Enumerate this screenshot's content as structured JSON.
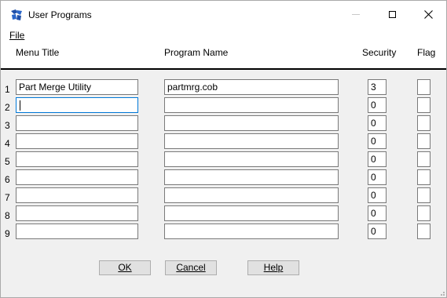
{
  "window": {
    "title": "User Programs",
    "icon": "app-icon",
    "controls": [
      "minimize-icon",
      "maximize-icon",
      "close-icon"
    ]
  },
  "menubar": {
    "items": [
      {
        "label": "File"
      }
    ]
  },
  "columns": {
    "menu_title": "Menu Title",
    "program_name": "Program Name",
    "security": "Security",
    "flag": "Flag"
  },
  "rows": [
    {
      "num": "1",
      "menu_title": "Part Merge Utility",
      "program_name": "partmrg.cob",
      "security": "3",
      "flag": ""
    },
    {
      "num": "2",
      "menu_title": "",
      "program_name": "",
      "security": "0",
      "flag": ""
    },
    {
      "num": "3",
      "menu_title": "",
      "program_name": "",
      "security": "0",
      "flag": ""
    },
    {
      "num": "4",
      "menu_title": "",
      "program_name": "",
      "security": "0",
      "flag": ""
    },
    {
      "num": "5",
      "menu_title": "",
      "program_name": "",
      "security": "0",
      "flag": ""
    },
    {
      "num": "6",
      "menu_title": "",
      "program_name": "",
      "security": "0",
      "flag": ""
    },
    {
      "num": "7",
      "menu_title": "",
      "program_name": "",
      "security": "0",
      "flag": ""
    },
    {
      "num": "8",
      "menu_title": "",
      "program_name": "",
      "security": "0",
      "flag": ""
    },
    {
      "num": "9",
      "menu_title": "",
      "program_name": "",
      "security": "0",
      "flag": ""
    }
  ],
  "buttons": {
    "ok": "OK",
    "cancel": "Cancel",
    "help": "Help"
  },
  "colors": {
    "focus_border": "#0078d7",
    "dialog_bg": "#f0f0f0"
  }
}
